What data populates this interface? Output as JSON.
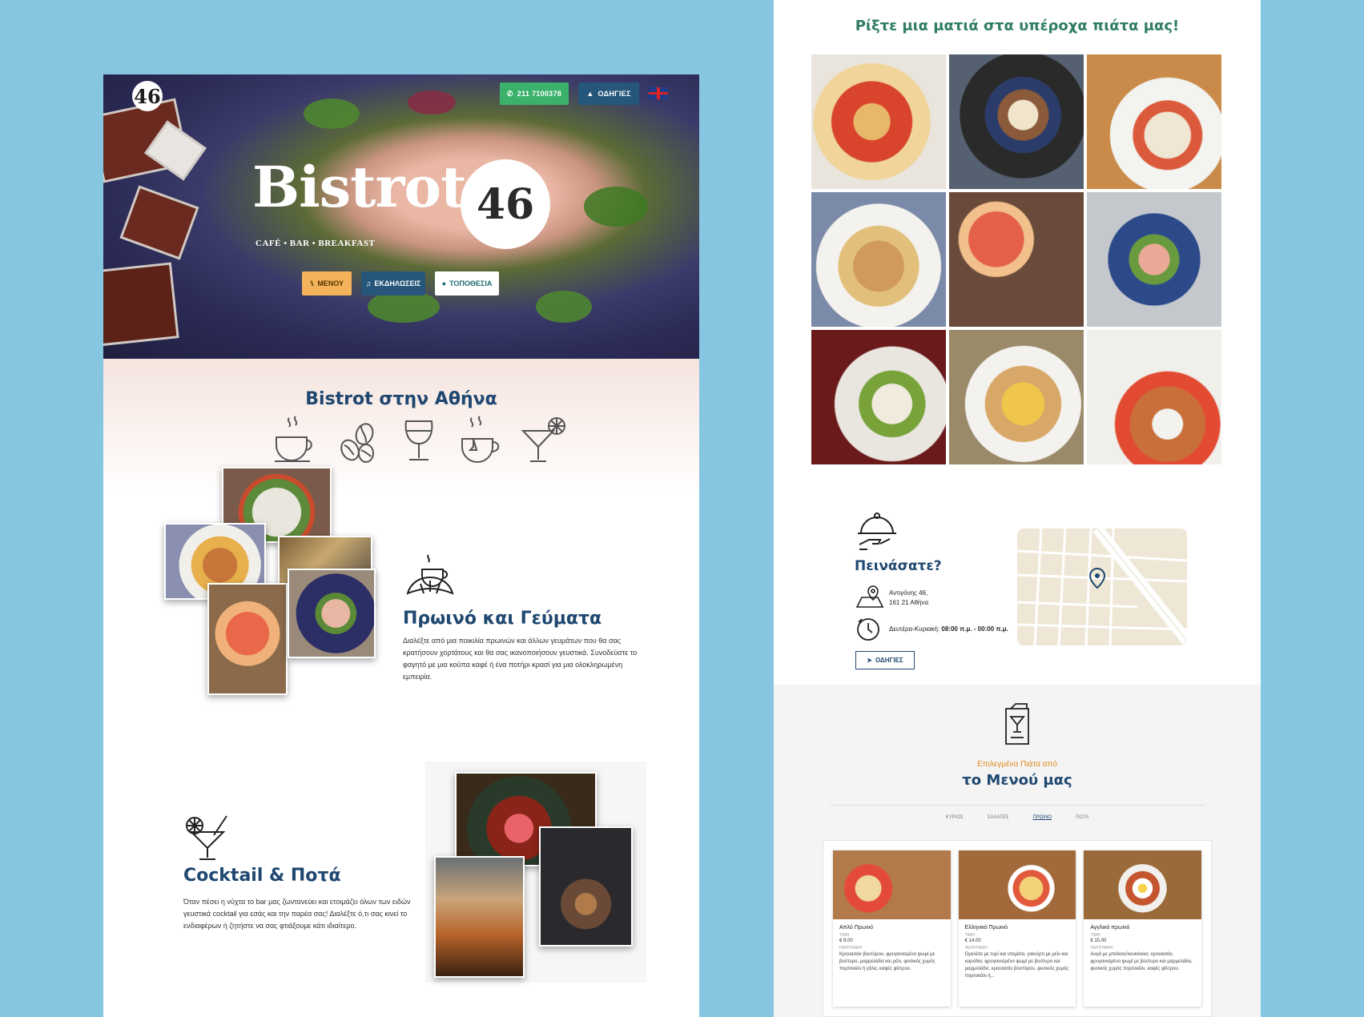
{
  "hero": {
    "logo": "46",
    "phone_label": "211 7100378",
    "directions_label": "ΟΔΗΓΙΕΣ",
    "language_flag": "uk-flag-icon",
    "brand_text": "Bistrot",
    "brand_number": "46",
    "tagline": "CAFÉ • BAR • BREAKFAST",
    "menu_btn": "ΜΕΝΟΥ",
    "events_btn": "ΕΚΔΗΛΩΣΕΙΣ",
    "location_btn": "ΤΟΠΟΘΕΣΙΑ"
  },
  "athens": {
    "title": "Bistrot στην Αθήνα",
    "icons": [
      "coffee-cup-icon",
      "coffee-beans-icon",
      "wine-glass-icon",
      "tea-cup-icon",
      "cocktail-icon"
    ]
  },
  "breakfast": {
    "title": "Πρωινό και Γεύματα",
    "text": "Διαλέξτε από μια ποικιλία πρωινών και άλλων γευμάτων που θα σας κρατήσουν χορτάτους και θα σας ικανοποιήσουν γευστικά. Συνοδεύστε το φαγητό με μια κούπα καφέ ή ένα ποτήρι κρασί για μια ολοκληρωμένη εμπειρία."
  },
  "cocktail": {
    "title": "Cocktail & Ποτά",
    "text": "Όταν πέσει η νύχτα το bar μας ζωντανεύει και ετοιμάζει όλων των ειδών γευστικά cocktail για εσάς και την παρέα σας! Διαλέξτε ό,τι σας κινεί το ενδιαφέρων ή ζητήστε να σας φτιάξουμε κάτι ιδιαίτερο."
  },
  "gallery": {
    "title": "Ρίξτε μια ματιά στα υπέροχα πιάτα μας!"
  },
  "hungry": {
    "title": "Πεινάσατε?",
    "address_line1": "Αντιγόνης 46,",
    "address_line2": "161 21 Αθήνα",
    "hours_label": "Δευτέρα-Κυριακή:",
    "hours_value": "08:00 π.μ. - 00:00 π.μ.",
    "directions_btn": "ΟΔΗΓΙΕΣ"
  },
  "menu": {
    "subtitle": "Επιλεγμένα Πιάτα από",
    "title": "το Μενού μας",
    "tabs": [
      "ΚΥΡΙΟΣ",
      "ΣΑΛΑΤΕΣ",
      "ΠΡΩΙΝΟ",
      "ΠΟΤΑ"
    ],
    "active_tab": "ΠΡΩΙΝΟ",
    "cards": [
      {
        "name": "Απλό Πρωινό",
        "price_label": "ΤΙΜΗ",
        "price": "€ 9.00",
        "desc_label": "ΠΕΡΙΓΡΑΦΗ",
        "desc": "Κρουασάν βουτύρου, φρυγανισμένο ψωμί με βούτυρο, μαρμελάδα και μέλι, φυσικός χυμός πορτοκάλι ή γάλα, καφές φίλτρου."
      },
      {
        "name": "Ελληνικό Πρωινό",
        "price_label": "ΤΙΜΗ",
        "price": "€ 14.00",
        "desc_label": "ΠΕΡΙΓΡΑΦΗ",
        "desc": "Ομελέτα με τυρί και ντομάτα, γιαούρτι με μέλι και καρύδια, φρυγανισμένο ψωμί με βούτυρο και μαρμελάδα, κρουασάν βουτύρου, φυσικός χυμός πορτοκάλι ή..."
      },
      {
        "name": "Αγγλικό πρωινό",
        "price_label": "ΤΙΜΗ",
        "price": "€ 15.00",
        "desc_label": "ΠΕΡΙΓΡΑΦΗ",
        "desc": "Αυγά με μπεϊκον/λουκάνικο, κρουασάν, φρυγανισμένο ψωμί με βούτυρο και μαρμελάδα, φυσικός χυμός πορτοκάλι, καφές φίλτρου."
      }
    ]
  },
  "colors": {
    "background": "#86c6e0",
    "brand_blue": "#1f4770",
    "green_accent": "#2f7d63",
    "orange_accent": "#e08a1e",
    "phone_button": "#3bb26b"
  }
}
